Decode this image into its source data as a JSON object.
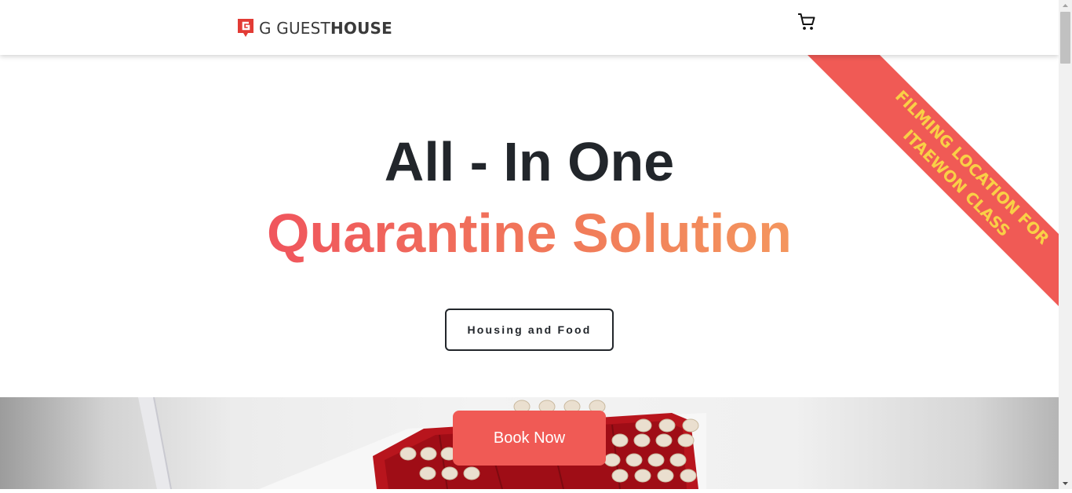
{
  "header": {
    "logo_prefix": "G GUEST",
    "logo_bold": "HOUSE",
    "logo_icon": "g-logo-icon",
    "cart_icon": "shopping-cart-icon"
  },
  "hero": {
    "title": "All - In One",
    "subtitle": "Quarantine Solution",
    "housing_button": "Housing and Food"
  },
  "ribbon": {
    "line1": "FILMING LOCATION FOR",
    "line2": "ITAEWON CLASS",
    "bg_color": "#f05a55",
    "text_color": "#f9d046"
  },
  "cta": {
    "book_button": "Book Now"
  },
  "colors": {
    "accent": "#f05a55",
    "text_dark": "#22262b"
  }
}
